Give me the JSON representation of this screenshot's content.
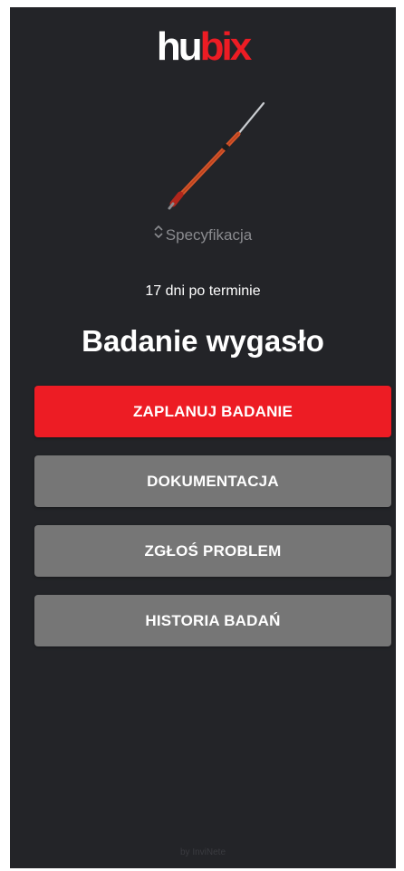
{
  "brand": {
    "logo_part1": "hu",
    "logo_part2": "bix"
  },
  "product": {
    "image": "lance-tool-image"
  },
  "spec": {
    "label": "Specyfikacja",
    "icon": "sort-chevrons-icon"
  },
  "status": {
    "overdue_text": "17 dni po terminie",
    "headline": "Badanie wygasło"
  },
  "actions": {
    "schedule": "ZAPLANUJ BADANIE",
    "documentation": "DOKUMENTACJA",
    "report_problem": "ZGŁOŚ PROBLEM",
    "history": "HISTORIA BADAŃ"
  },
  "footer": {
    "credit": "by InviNete"
  },
  "colors": {
    "background": "#232428",
    "accent": "#ed1c24",
    "secondary_button": "#767676",
    "muted_text": "#8a8b8f"
  }
}
